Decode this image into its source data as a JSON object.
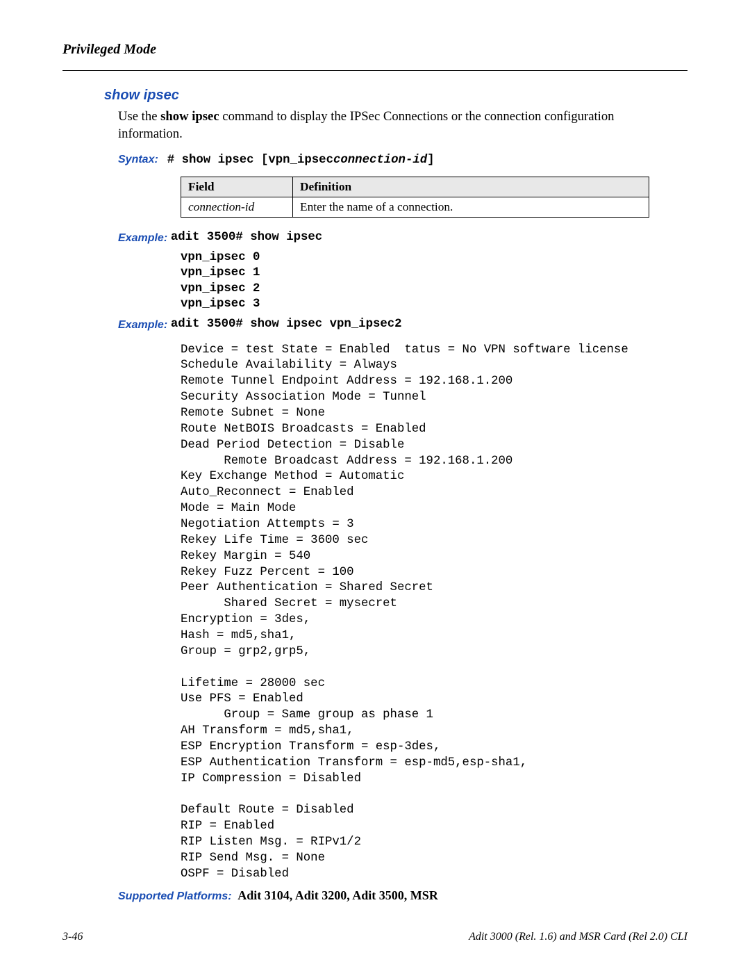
{
  "header": "Privileged Mode",
  "command_title": "show ipsec",
  "description_pre": "Use the ",
  "description_bold": "show ipsec",
  "description_post": " command to display the IPSec Connections or the connection configuration information.",
  "syntax": {
    "label": "Syntax:",
    "prefix": "# show ipsec [vpn_ipsec",
    "param": "connection-id",
    "suffix": "]"
  },
  "table": {
    "headers": [
      "Field",
      "Definition"
    ],
    "rows": [
      [
        "connection-id",
        "Enter the name of a connection."
      ]
    ]
  },
  "example1": {
    "label": "Example:",
    "cmd": "adit 3500# show ipsec",
    "lines": "vpn_ipsec 0\nvpn_ipsec 1\nvpn_ipsec 2\nvpn_ipsec 3"
  },
  "example2": {
    "label": "Example:",
    "cmd": "adit 3500# show ipsec vpn_ipsec2",
    "output": "Device = test State = Enabled  tatus = No VPN software license\nSchedule Availability = Always\nRemote Tunnel Endpoint Address = 192.168.1.200\nSecurity Association Mode = Tunnel\nRemote Subnet = None\nRoute NetBOIS Broadcasts = Enabled\nDead Period Detection = Disable\n      Remote Broadcast Address = 192.168.1.200\nKey Exchange Method = Automatic\nAuto_Reconnect = Enabled\nMode = Main Mode\nNegotiation Attempts = 3\nRekey Life Time = 3600 sec\nRekey Margin = 540\nRekey Fuzz Percent = 100\nPeer Authentication = Shared Secret\n      Shared Secret = mysecret\nEncryption = 3des,\nHash = md5,sha1,\nGroup = grp2,grp5,\n\nLifetime = 28000 sec\nUse PFS = Enabled\n      Group = Same group as phase 1\nAH Transform = md5,sha1,\nESP Encryption Transform = esp-3des,\nESP Authentication Transform = esp-md5,esp-sha1,\nIP Compression = Disabled\n\nDefault Route = Disabled\nRIP = Enabled\nRIP Listen Msg. = RIPv1/2\nRIP Send Msg. = None\nOSPF = Disabled"
  },
  "supported": {
    "label": "Supported Platforms:",
    "value": "Adit 3104, Adit 3200, Adit 3500, MSR"
  },
  "footer": {
    "left": "3-46",
    "right": "Adit 3000 (Rel. 1.6) and MSR Card (Rel 2.0) CLI"
  }
}
